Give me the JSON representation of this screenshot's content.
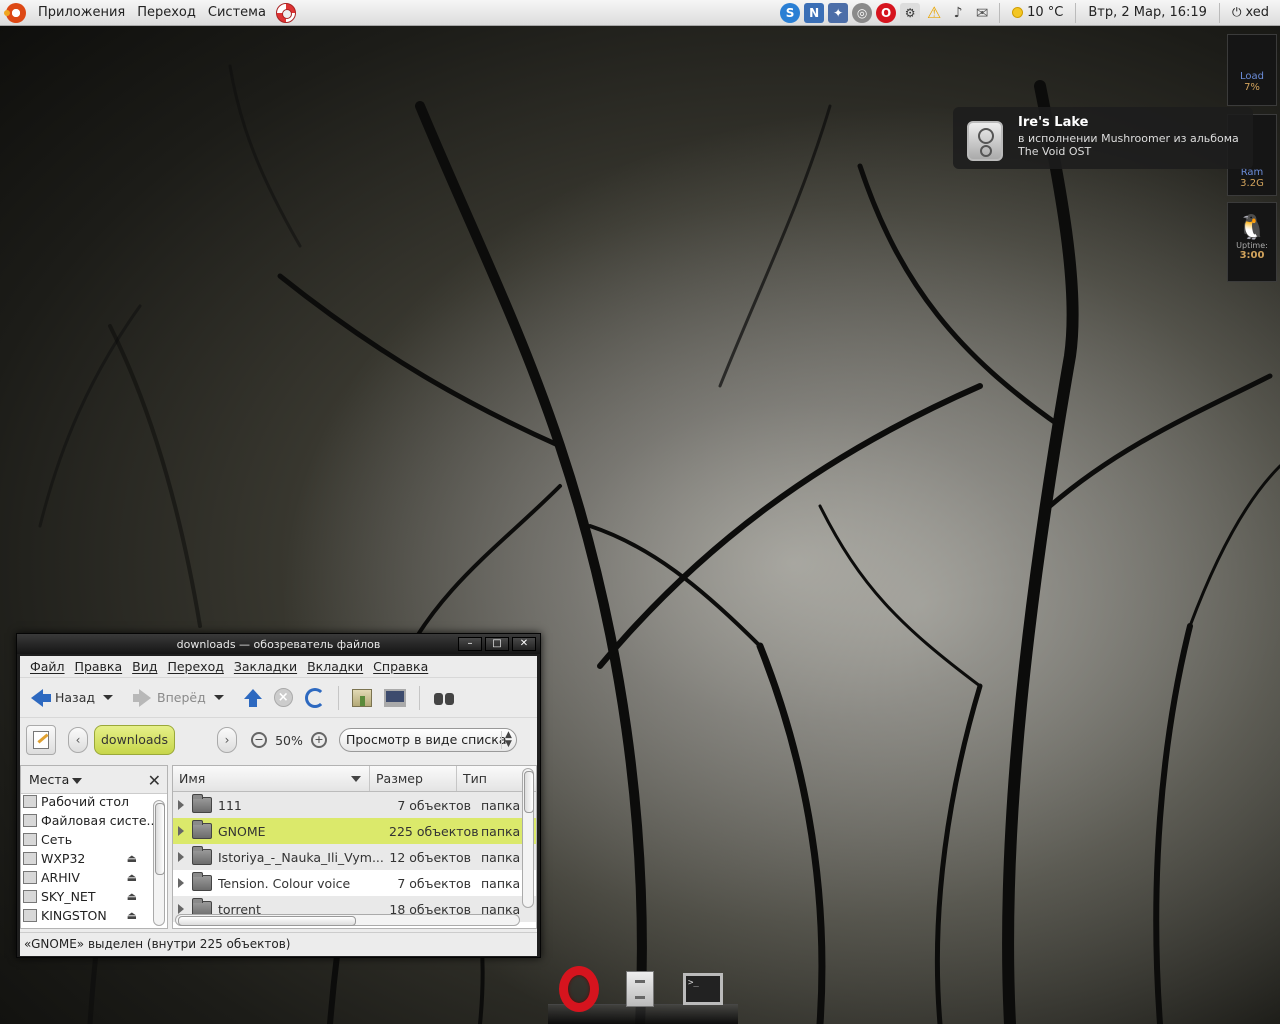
{
  "top_panel": {
    "menus": [
      "Приложения",
      "Переход",
      "Система"
    ],
    "weather": "10 °C",
    "datetime": "Втр,  2 Мар, 16:19",
    "user": "xed",
    "tray_icons": [
      "skype-icon",
      "pidgin-icon",
      "puzzle-icon",
      "dropbox-icon",
      "opera-icon",
      "network-icon",
      "warning-icon",
      "volume-icon",
      "mail-icon"
    ]
  },
  "monitors": {
    "load": {
      "label": "Load",
      "value": "7%"
    },
    "ram": {
      "label": "Ram",
      "value": "3.2G"
    },
    "uptime": {
      "label": "Uptime:",
      "value": "3:00"
    }
  },
  "notification": {
    "title": "Ire's Lake",
    "text": "в исполнении Mushroomer из альбома The Void OST"
  },
  "file_manager": {
    "title": "downloads — обозреватель файлов",
    "menu": [
      "Файл",
      "Правка",
      "Вид",
      "Переход",
      "Закладки",
      "Вкладки",
      "Справка"
    ],
    "toolbar": {
      "back": "Назад",
      "forward": "Вперёд"
    },
    "location": {
      "current": "downloads",
      "zoom": "50%",
      "view_mode": "Просмотр в виде списка"
    },
    "sidebar": {
      "header": "Места",
      "items": [
        {
          "label": "Рабочий стол",
          "eject": false
        },
        {
          "label": "Файловая систе...",
          "eject": false
        },
        {
          "label": "Сеть",
          "eject": false
        },
        {
          "label": "WXP32",
          "eject": true
        },
        {
          "label": "ARHIV",
          "eject": true
        },
        {
          "label": "SKY_NET",
          "eject": true
        },
        {
          "label": "KINGSTON",
          "eject": true
        }
      ]
    },
    "columns": {
      "name": "Имя",
      "size": "Размер",
      "type": "Тип"
    },
    "rows": [
      {
        "name": "111",
        "size": "7 объектов",
        "type": "папка"
      },
      {
        "name": "GNOME",
        "size": "225 объектов",
        "type": "папка"
      },
      {
        "name": "Istoriya_-_Nauka_Ili_Vym...",
        "size": "12 объектов",
        "type": "папка"
      },
      {
        "name": "Tension. Colour voice",
        "size": "7 объектов",
        "type": "папка"
      },
      {
        "name": "torrent",
        "size": "18 объектов",
        "type": "папка"
      }
    ],
    "status": "«GNOME» выделен (внутри 225 объектов)"
  },
  "colors": {
    "selection": "#dbe96b",
    "breadcrumb": "#d4e05a",
    "accent_blue": "#2d69c0"
  }
}
